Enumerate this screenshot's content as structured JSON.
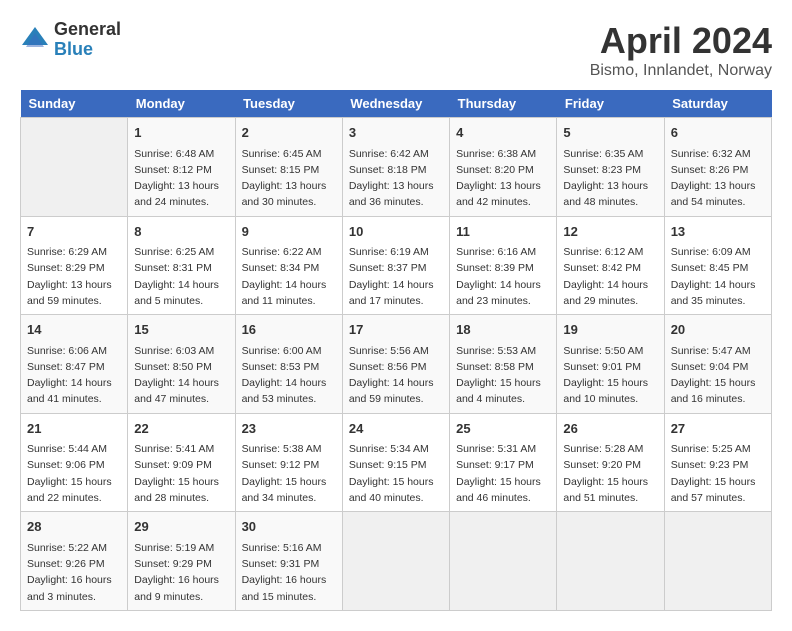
{
  "header": {
    "logo_line1": "General",
    "logo_line2": "Blue",
    "month_title": "April 2024",
    "location": "Bismo, Innlandet, Norway"
  },
  "days_of_week": [
    "Sunday",
    "Monday",
    "Tuesday",
    "Wednesday",
    "Thursday",
    "Friday",
    "Saturday"
  ],
  "weeks": [
    [
      {
        "day": "",
        "info": ""
      },
      {
        "day": "1",
        "info": "Sunrise: 6:48 AM\nSunset: 8:12 PM\nDaylight: 13 hours\nand 24 minutes."
      },
      {
        "day": "2",
        "info": "Sunrise: 6:45 AM\nSunset: 8:15 PM\nDaylight: 13 hours\nand 30 minutes."
      },
      {
        "day": "3",
        "info": "Sunrise: 6:42 AM\nSunset: 8:18 PM\nDaylight: 13 hours\nand 36 minutes."
      },
      {
        "day": "4",
        "info": "Sunrise: 6:38 AM\nSunset: 8:20 PM\nDaylight: 13 hours\nand 42 minutes."
      },
      {
        "day": "5",
        "info": "Sunrise: 6:35 AM\nSunset: 8:23 PM\nDaylight: 13 hours\nand 48 minutes."
      },
      {
        "day": "6",
        "info": "Sunrise: 6:32 AM\nSunset: 8:26 PM\nDaylight: 13 hours\nand 54 minutes."
      }
    ],
    [
      {
        "day": "7",
        "info": "Sunrise: 6:29 AM\nSunset: 8:29 PM\nDaylight: 13 hours\nand 59 minutes."
      },
      {
        "day": "8",
        "info": "Sunrise: 6:25 AM\nSunset: 8:31 PM\nDaylight: 14 hours\nand 5 minutes."
      },
      {
        "day": "9",
        "info": "Sunrise: 6:22 AM\nSunset: 8:34 PM\nDaylight: 14 hours\nand 11 minutes."
      },
      {
        "day": "10",
        "info": "Sunrise: 6:19 AM\nSunset: 8:37 PM\nDaylight: 14 hours\nand 17 minutes."
      },
      {
        "day": "11",
        "info": "Sunrise: 6:16 AM\nSunset: 8:39 PM\nDaylight: 14 hours\nand 23 minutes."
      },
      {
        "day": "12",
        "info": "Sunrise: 6:12 AM\nSunset: 8:42 PM\nDaylight: 14 hours\nand 29 minutes."
      },
      {
        "day": "13",
        "info": "Sunrise: 6:09 AM\nSunset: 8:45 PM\nDaylight: 14 hours\nand 35 minutes."
      }
    ],
    [
      {
        "day": "14",
        "info": "Sunrise: 6:06 AM\nSunset: 8:47 PM\nDaylight: 14 hours\nand 41 minutes."
      },
      {
        "day": "15",
        "info": "Sunrise: 6:03 AM\nSunset: 8:50 PM\nDaylight: 14 hours\nand 47 minutes."
      },
      {
        "day": "16",
        "info": "Sunrise: 6:00 AM\nSunset: 8:53 PM\nDaylight: 14 hours\nand 53 minutes."
      },
      {
        "day": "17",
        "info": "Sunrise: 5:56 AM\nSunset: 8:56 PM\nDaylight: 14 hours\nand 59 minutes."
      },
      {
        "day": "18",
        "info": "Sunrise: 5:53 AM\nSunset: 8:58 PM\nDaylight: 15 hours\nand 4 minutes."
      },
      {
        "day": "19",
        "info": "Sunrise: 5:50 AM\nSunset: 9:01 PM\nDaylight: 15 hours\nand 10 minutes."
      },
      {
        "day": "20",
        "info": "Sunrise: 5:47 AM\nSunset: 9:04 PM\nDaylight: 15 hours\nand 16 minutes."
      }
    ],
    [
      {
        "day": "21",
        "info": "Sunrise: 5:44 AM\nSunset: 9:06 PM\nDaylight: 15 hours\nand 22 minutes."
      },
      {
        "day": "22",
        "info": "Sunrise: 5:41 AM\nSunset: 9:09 PM\nDaylight: 15 hours\nand 28 minutes."
      },
      {
        "day": "23",
        "info": "Sunrise: 5:38 AM\nSunset: 9:12 PM\nDaylight: 15 hours\nand 34 minutes."
      },
      {
        "day": "24",
        "info": "Sunrise: 5:34 AM\nSunset: 9:15 PM\nDaylight: 15 hours\nand 40 minutes."
      },
      {
        "day": "25",
        "info": "Sunrise: 5:31 AM\nSunset: 9:17 PM\nDaylight: 15 hours\nand 46 minutes."
      },
      {
        "day": "26",
        "info": "Sunrise: 5:28 AM\nSunset: 9:20 PM\nDaylight: 15 hours\nand 51 minutes."
      },
      {
        "day": "27",
        "info": "Sunrise: 5:25 AM\nSunset: 9:23 PM\nDaylight: 15 hours\nand 57 minutes."
      }
    ],
    [
      {
        "day": "28",
        "info": "Sunrise: 5:22 AM\nSunset: 9:26 PM\nDaylight: 16 hours\nand 3 minutes."
      },
      {
        "day": "29",
        "info": "Sunrise: 5:19 AM\nSunset: 9:29 PM\nDaylight: 16 hours\nand 9 minutes."
      },
      {
        "day": "30",
        "info": "Sunrise: 5:16 AM\nSunset: 9:31 PM\nDaylight: 16 hours\nand 15 minutes."
      },
      {
        "day": "",
        "info": ""
      },
      {
        "day": "",
        "info": ""
      },
      {
        "day": "",
        "info": ""
      },
      {
        "day": "",
        "info": ""
      }
    ]
  ]
}
